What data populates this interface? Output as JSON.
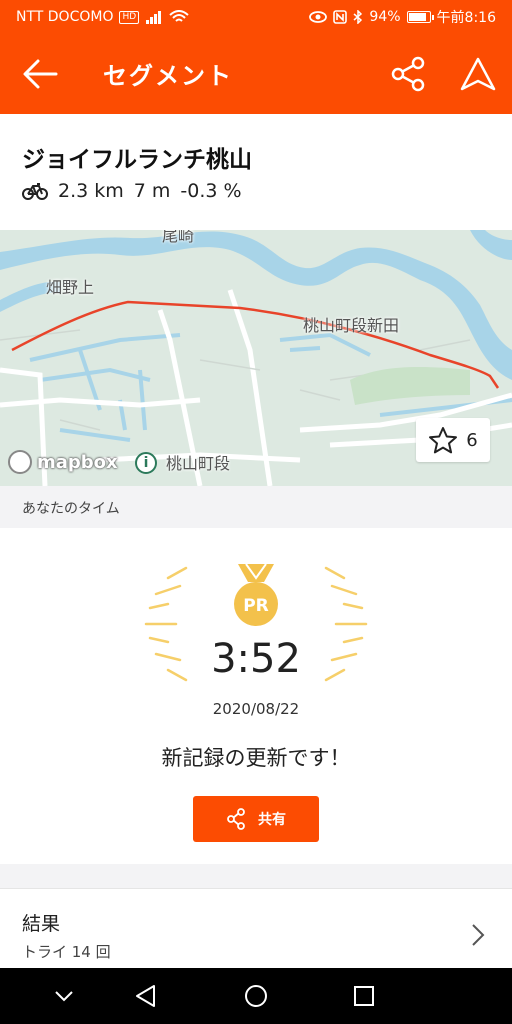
{
  "status_bar": {
    "carrier": "NTT DOCOMO",
    "network_badge": "HD",
    "battery": "94%",
    "battery_level": 0.94,
    "time": "午前8:16"
  },
  "app_bar": {
    "title": "セグメント",
    "icons": [
      "back-arrow-icon",
      "share-icon",
      "navigate-icon"
    ]
  },
  "segment": {
    "name": "ジョイフルランチ桃山",
    "distance": "2.3 km",
    "elevation": "7 m",
    "grade": "-0.3 %"
  },
  "map": {
    "labels": [
      "尾崎",
      "畑野上",
      "桃山町段新田",
      "桃山町段"
    ],
    "attribution": "mapbox",
    "star_count": "6",
    "route_color": "#e8442a"
  },
  "your_time": {
    "section_label": "あなたのタイム",
    "badge": "PR",
    "time": "3:52",
    "date": "2020/08/22",
    "message": "新記録の更新です！",
    "share_label": "共有"
  },
  "results": {
    "title": "結果",
    "subtitle": "トライ 14 回"
  },
  "colors": {
    "brand": "#fc4c02",
    "medal": "#f3c14b",
    "rays": "#f6cf6a"
  }
}
